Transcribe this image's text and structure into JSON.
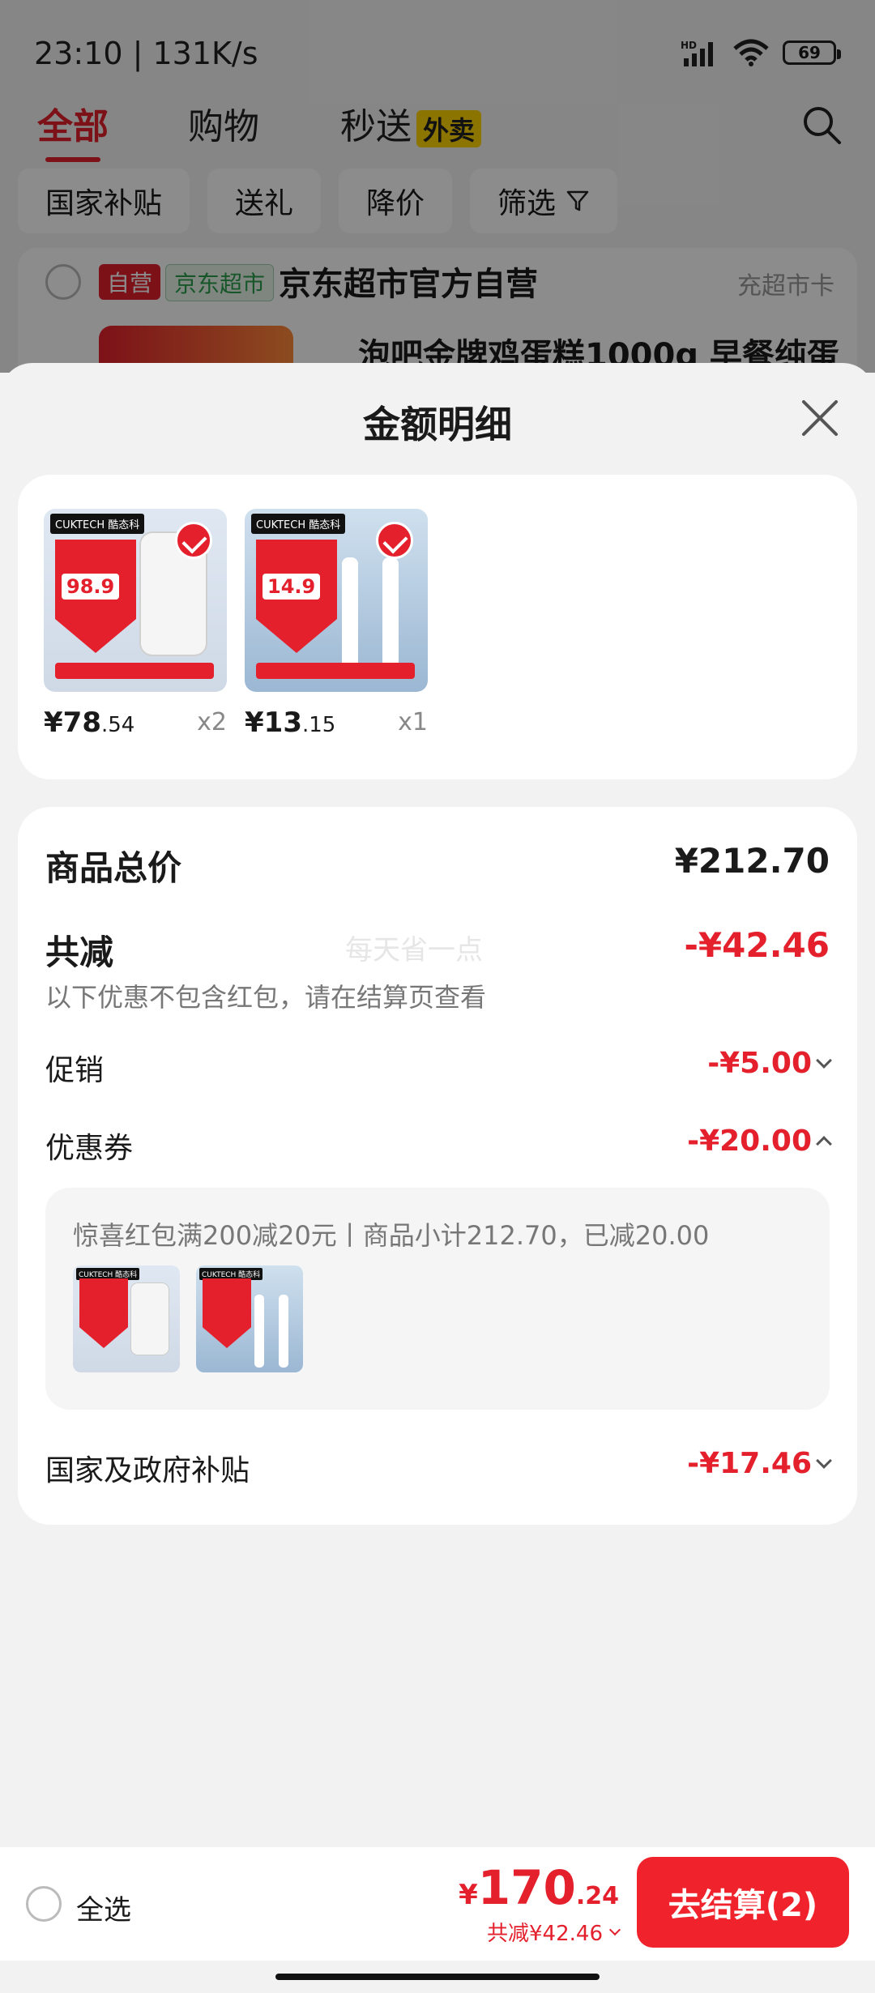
{
  "status_bar": {
    "time": "23:10 | 131K/s",
    "battery": "69"
  },
  "top_tabs": {
    "all": "全部",
    "shopping": "购物",
    "flash": "秒送",
    "waimai": "外卖"
  },
  "filters": [
    "国家补贴",
    "送礼",
    "降价",
    "筛选"
  ],
  "background_card": {
    "self_tag": "自营",
    "market_tag": "京东超市",
    "shop_name": "京东超市官方自营",
    "recharge": "充超市卡",
    "product_title": "泡吧金牌鸡蛋糕1000g 早餐纯蛋"
  },
  "sheet": {
    "title": "金额明细",
    "products": [
      {
        "price_int": "¥78",
        "price_dec": ".54",
        "qty": "x2",
        "brand": "CUKTECH 酷态科"
      },
      {
        "price_int": "¥13",
        "price_dec": ".15",
        "qty": "x1",
        "brand": "CUKTECH 酷态科"
      }
    ],
    "total": {
      "label": "商品总价",
      "value": "¥212.70"
    },
    "reduce": {
      "label": "共减",
      "value": "-¥42.46",
      "watermark": "每天省一点",
      "hint": "以下优惠不包含红包，请在结算页查看"
    },
    "promo": {
      "label": "促销",
      "value": "-¥5.00"
    },
    "coupon": {
      "label": "优惠券",
      "value": "-¥20.00",
      "desc": "惊喜红包满200减20元丨商品小计212.70，已减20.00"
    },
    "subsidy": {
      "label": "国家及政府补贴",
      "value": "-¥17.46"
    }
  },
  "bottom_bar": {
    "select_all": "全选",
    "yen": "¥",
    "total_int": "170",
    "total_dec": ".24",
    "reduce": "共减¥42.46",
    "checkout": "去结算(2)"
  },
  "colors": {
    "accent": "#e4202d",
    "checkout": "#f0222b"
  }
}
